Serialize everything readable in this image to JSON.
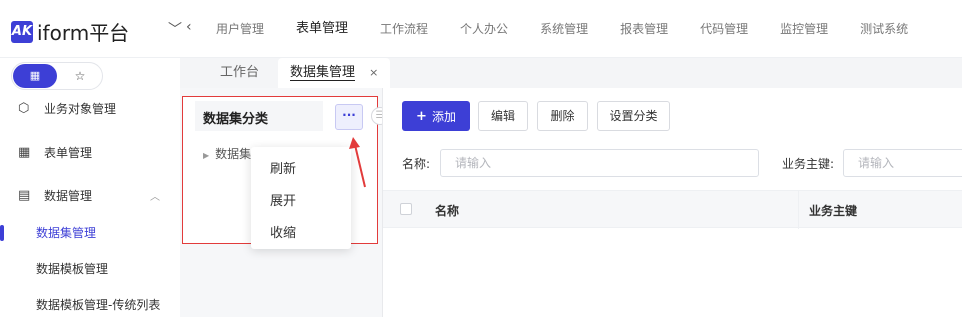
{
  "app": {
    "logo_mark": "AK",
    "title": "iform平台",
    "collapse_glyph": "﹀",
    "back_glyph": "‹"
  },
  "top_nav": [
    {
      "label": "用户管理",
      "active": false
    },
    {
      "label": "表单管理",
      "active": true
    },
    {
      "label": "工作流程",
      "active": false
    },
    {
      "label": "个人办公",
      "active": false
    },
    {
      "label": "系统管理",
      "active": false
    },
    {
      "label": "报表管理",
      "active": false
    },
    {
      "label": "代码管理",
      "active": false
    },
    {
      "label": "监控管理",
      "active": false
    },
    {
      "label": "测试系统",
      "active": false
    }
  ],
  "sidebar": {
    "toggle": {
      "left_icon": "grid-icon",
      "right_icon": "star-icon",
      "left_glyph": "▦",
      "right_glyph": "☆"
    },
    "menu": [
      {
        "label": "业务对象管理",
        "icon": "cube-icon",
        "glyph": "⬡"
      },
      {
        "label": "表单管理",
        "icon": "table-icon",
        "glyph": "▦"
      },
      {
        "label": "数据管理",
        "icon": "database-icon",
        "glyph": "▤",
        "chevron": "︿"
      }
    ],
    "submenu": [
      {
        "label": "数据集管理",
        "active": true
      },
      {
        "label": "数据模板管理",
        "active": false
      },
      {
        "label": "数据模板管理-传统列表",
        "active": false
      }
    ]
  },
  "tabs": [
    {
      "label": "工作台",
      "active": false
    },
    {
      "label": "数据集管理",
      "active": true,
      "close": "×"
    }
  ],
  "tree": {
    "title": "数据集分类",
    "more_glyph": "···",
    "node_caret": "▶",
    "node_label": "数据集",
    "splitter_glyph": "☰",
    "dropdown": [
      "刷新",
      "展开",
      "收缩"
    ]
  },
  "toolbar": {
    "add_plus": "+",
    "add": "添加",
    "edit": "编辑",
    "delete": "删除",
    "set_category": "设置分类"
  },
  "filters": {
    "name_label": "名称:",
    "name_placeholder": "请输入",
    "key_label": "业务主键:",
    "key_placeholder": "请输入"
  },
  "table": {
    "columns": [
      "名称",
      "业务主键"
    ]
  },
  "colors": {
    "accent": "#3d3fd6",
    "highlight_border": "#e23b3b"
  }
}
